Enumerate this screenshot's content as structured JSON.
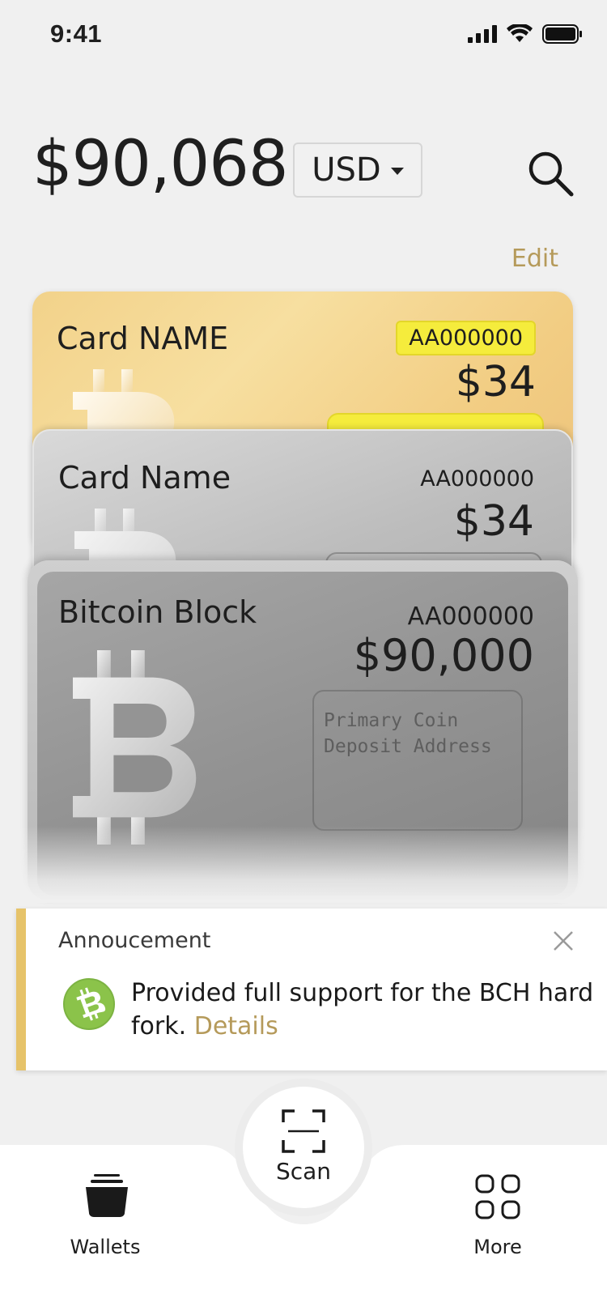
{
  "status_bar": {
    "time": "9:41"
  },
  "header": {
    "total_balance": "$90,068",
    "currency": "USD",
    "edit_label": "Edit"
  },
  "cards": [
    {
      "name": "Card NAME",
      "id": "AA000000",
      "amount": "$34",
      "style": "gold",
      "accent": "#f2d28a"
    },
    {
      "name": "Card Name",
      "id": "AA000000",
      "amount": "$34",
      "style": "silver",
      "accent": "#bdbdbd"
    },
    {
      "name": "Bitcoin Block",
      "id": "AA000000",
      "amount": "$90,000",
      "style": "gray",
      "accent": "#939393",
      "address_line1": "Primary Coin",
      "address_line2": "Deposit Address"
    }
  ],
  "announcement": {
    "title": "Annoucement",
    "message": "Provided full support for the BCH hard fork.",
    "link_label": "Details",
    "accent_color": "#e6c36a",
    "icon": "bch-icon"
  },
  "tabbar": {
    "wallets_label": "Wallets",
    "scan_label": "Scan",
    "more_label": "More"
  },
  "colors": {
    "background": "#f0f0f0",
    "link": "#b59a5a",
    "highlight_yellow": "#f5ec3c"
  }
}
